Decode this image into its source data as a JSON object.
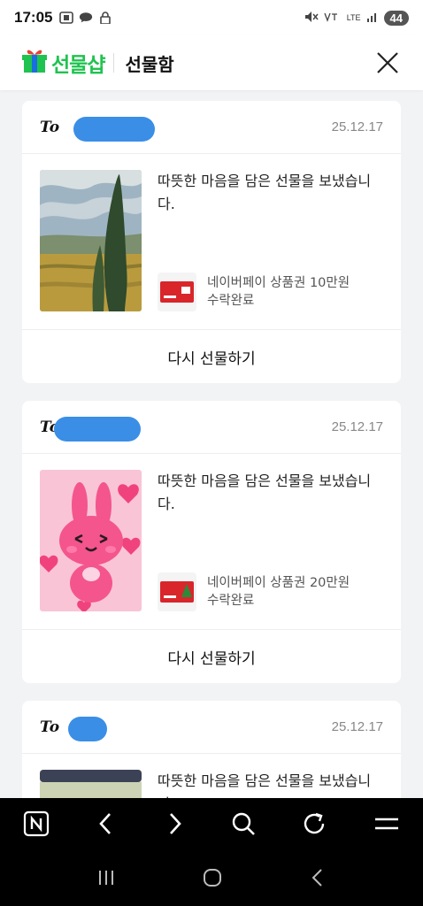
{
  "status": {
    "time": "17:05",
    "network": "LTE",
    "battery": "44",
    "icons_left": [
      "screenshot-icon",
      "talk-icon",
      "lock-icon"
    ],
    "icons_right": [
      "mute-icon",
      "volte-icon",
      "lte-icon",
      "signal-icon"
    ]
  },
  "header": {
    "logo_text": "선물샵",
    "title": "선물함"
  },
  "cards": [
    {
      "to": "To",
      "date": "25.12.17",
      "message": "따뜻한 마음을 담은 선물을 보냈습니다.",
      "product_name": "네이버페이 상품권 10만원",
      "status": "수락완료",
      "action": "다시 선물하기"
    },
    {
      "to": "To",
      "date": "25.12.17",
      "message": "따뜻한 마음을 담은 선물을 보냈습니다.",
      "product_name": "네이버페이 상품권 20만원",
      "status": "수락완료",
      "action": "다시 선물하기"
    },
    {
      "to": "To",
      "date": "25.12.17",
      "message": "따뜻한 마음을 담은 선물을 보냈습니다."
    }
  ],
  "colors": {
    "brand_green": "#1fc34f",
    "redaction_blue": "#3a8ee6",
    "page_bg": "#f2f3f5"
  }
}
